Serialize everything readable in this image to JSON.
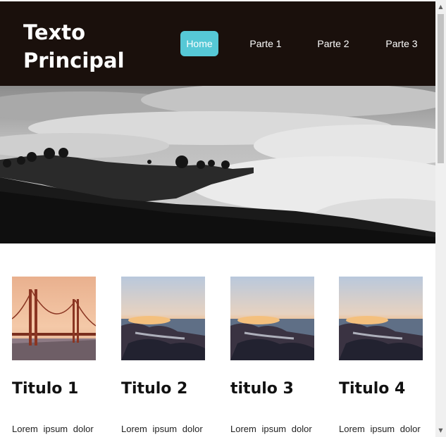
{
  "header": {
    "title": "Texto Principal",
    "nav": [
      {
        "label": "Home",
        "active": true
      },
      {
        "label": "Parte 1"
      },
      {
        "label": "Parte 2"
      },
      {
        "label": "Parte 3"
      }
    ]
  },
  "colors": {
    "header_bg": "#1a100c",
    "nav_active": "#56c8d6"
  },
  "hero": {
    "image": "black-and-white-landscape-icon"
  },
  "cards": [
    {
      "title": "Titulo 1",
      "text": "Lorem ipsum dolor",
      "image": "golden-gate-bridge-icon"
    },
    {
      "title": "Titulo 2",
      "text": "Lorem ipsum dolor",
      "image": "rocky-coast-sunset-icon"
    },
    {
      "title": "titulo 3",
      "text": "Lorem ipsum dolor",
      "image": "rocky-coast-sunset-icon"
    },
    {
      "title": "Titulo 4",
      "text": "Lorem ipsum dolor",
      "image": "rocky-coast-sunset-icon"
    }
  ]
}
